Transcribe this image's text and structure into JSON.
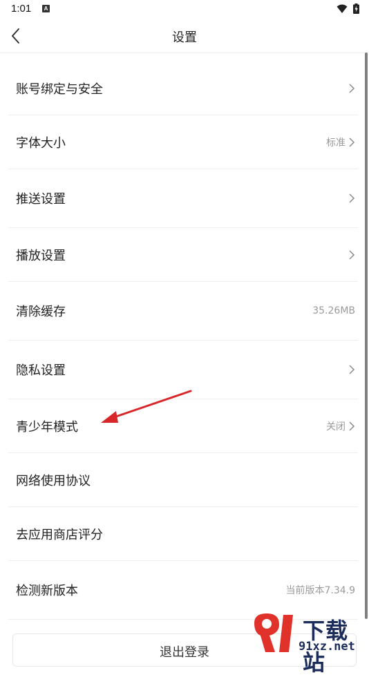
{
  "status_bar": {
    "time": "1:01",
    "a_icon": "A"
  },
  "header": {
    "title": "设置"
  },
  "settings": [
    {
      "label": "账号绑定与安全",
      "value": "",
      "chevron": true
    },
    {
      "label": "字体大小",
      "value": "标准",
      "chevron": true
    },
    {
      "label": "推送设置",
      "value": "",
      "chevron": true
    },
    {
      "label": "播放设置",
      "value": "",
      "chevron": true
    },
    {
      "label": "清除缓存",
      "value": "35.26MB",
      "chevron": false
    },
    {
      "label": "隐私设置",
      "value": "",
      "chevron": true
    },
    {
      "label": "青少年模式",
      "value": "关闭",
      "chevron": true
    },
    {
      "label": "网络使用协议",
      "value": "",
      "chevron": false
    },
    {
      "label": "去应用商店评分",
      "value": "",
      "chevron": false
    },
    {
      "label": "检测新版本",
      "value": "当前版本7.34.9",
      "chevron": false
    }
  ],
  "logout": {
    "label": "退出登录"
  },
  "watermark": {
    "brand": "下载站",
    "url": "91xz.net"
  },
  "colors": {
    "annotation_arrow": "#d8262a",
    "watermark_red": "#e0322b",
    "watermark_navy": "#1c2d5c"
  }
}
